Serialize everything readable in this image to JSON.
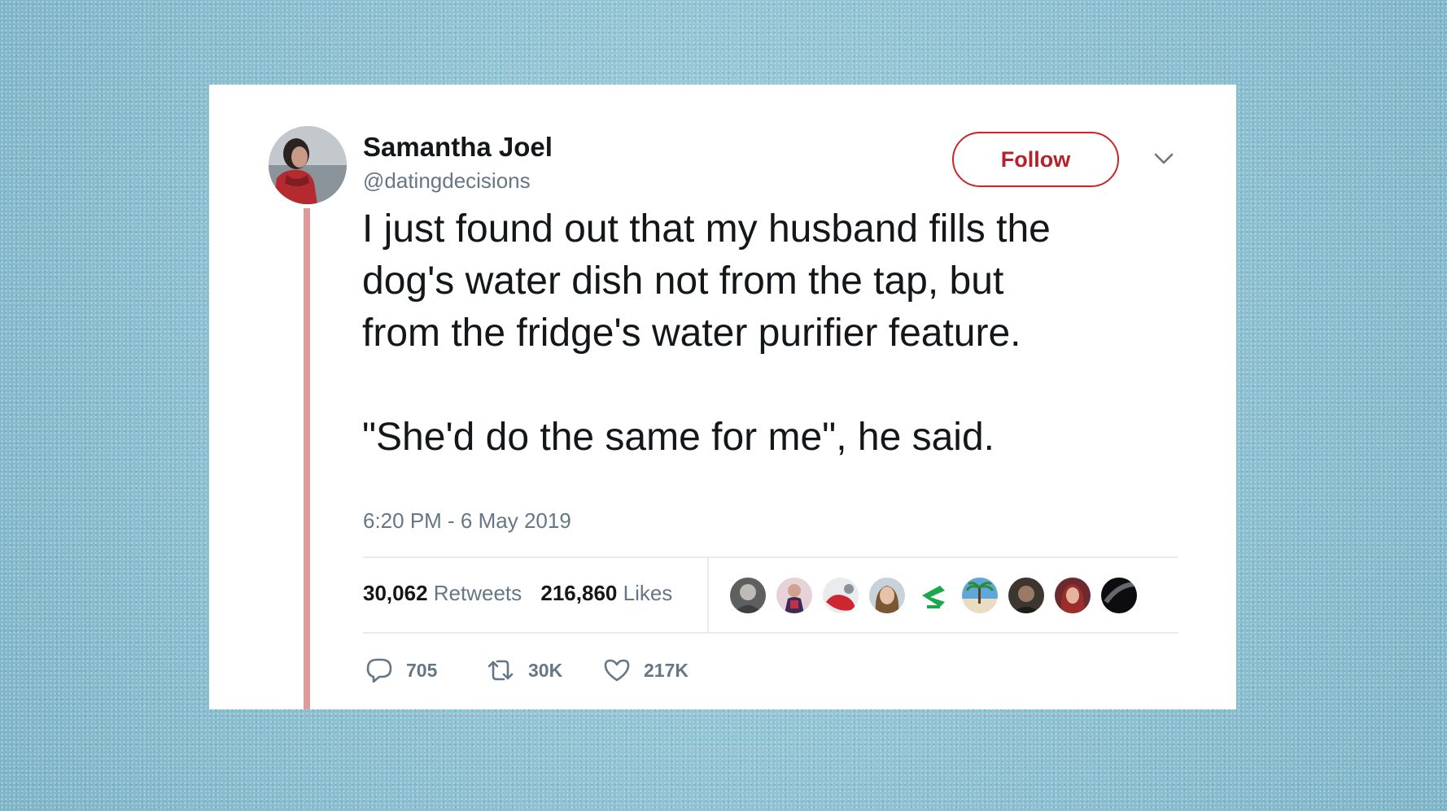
{
  "tweet": {
    "author_name": "Samantha Joel",
    "author_handle": "@datingdecisions",
    "follow_label": "Follow",
    "text_lines": [
      "I just found out that my husband fills the",
      "dog's water dish not from the tap, but",
      "from the fridge's water purifier feature.",
      "\"She'd do the same for me\", he said."
    ],
    "timestamp": "6:20 PM - 6 May 2019",
    "stats": {
      "retweets_count": "30,062",
      "retweets_label": "Retweets",
      "likes_count": "216,860",
      "likes_label": "Likes"
    },
    "actions": {
      "replies": "705",
      "retweets": "30K",
      "likes": "217K"
    }
  },
  "colors": {
    "background": "#8fc3d3",
    "card": "#ffffff",
    "follow_accent": "#c8262a",
    "thread_line": "#e09a9a",
    "secondary_text": "#657786",
    "primary_text": "#14171a"
  },
  "icons": {
    "reply": "speech-bubble-icon",
    "retweet": "retweet-arrows-icon",
    "like": "heart-icon",
    "menu": "chevron-down-icon"
  }
}
